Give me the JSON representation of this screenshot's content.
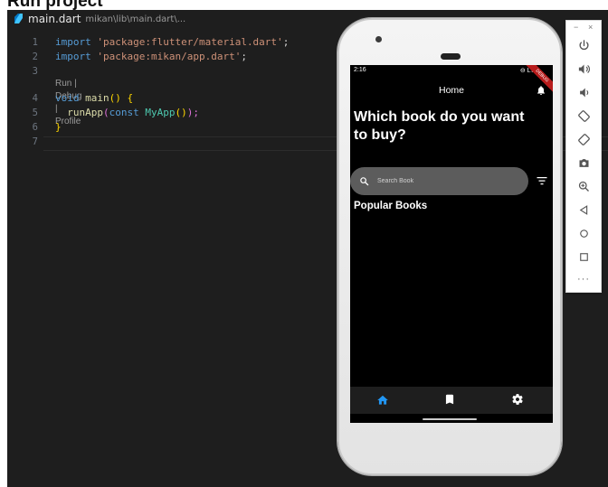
{
  "page": {
    "heading": "Run project"
  },
  "editor": {
    "tab": {
      "file_name": "main.dart",
      "file_path": "mikan\\lib\\main.dart\\..."
    },
    "line_numbers": [
      "1",
      "2",
      "3",
      "4",
      "5",
      "6",
      "7"
    ],
    "codelens": "Run | Debug | Profile",
    "code": {
      "l1_kw": "import",
      "l1_str": "'package:flutter/material.dart'",
      "l1_end": ";",
      "l2_kw": "import",
      "l2_str": "'package:mikan/app.dart'",
      "l2_end": ";",
      "l4_kw": "void",
      "l4_fn": "main",
      "l4_rest": "() {",
      "l5_fn": "runApp",
      "l5_p1": "(",
      "l5_kw": "const",
      "l5_cls": "MyApp",
      "l5_p2": "()",
      "l5_p3": ");",
      "l6": "}"
    }
  },
  "device": {
    "status": {
      "time": "2:16",
      "right": "⊖ LTE",
      "ribbon": "DEBUG"
    },
    "appbar": {
      "title": "Home"
    },
    "hero": "Which book do you want to buy?",
    "search": {
      "placeholder": "Search Book"
    },
    "section_title": "Popular Books",
    "bottom_nav": {
      "active_color": "#2196f3",
      "inactive_color": "#ffffff"
    }
  },
  "toolbar": {
    "minimize": "−",
    "close": "×",
    "more": "···"
  },
  "colors": {
    "editor_bg": "#1e1e1e",
    "keyword": "#569cd6",
    "string": "#ce9178",
    "function": "#dcdcaa",
    "class": "#4ec9b0",
    "search_bg": "#5c5c5c"
  }
}
